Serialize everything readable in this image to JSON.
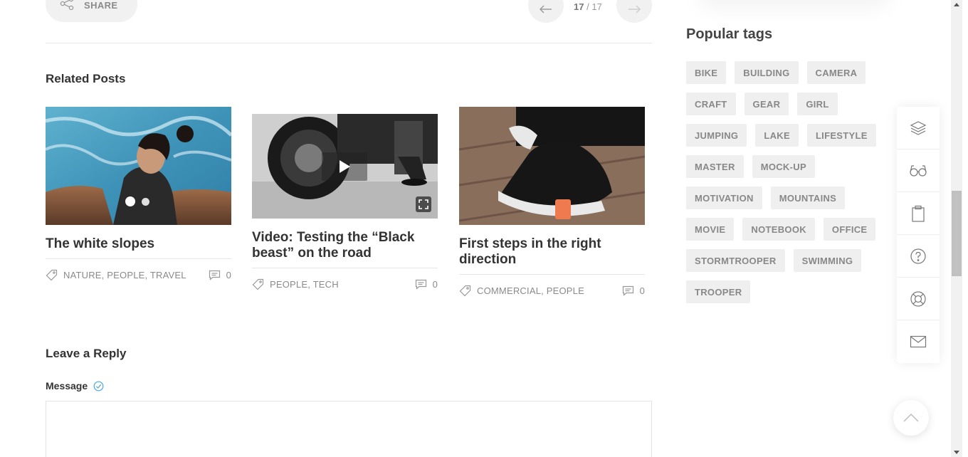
{
  "share": {
    "label": "SHARE"
  },
  "pager": {
    "current": "17",
    "total": "17",
    "separator": "/"
  },
  "related": {
    "title": "Related Posts",
    "posts": [
      {
        "title": "The white slopes",
        "tags": "NATURE, PEOPLE, TRAVEL",
        "comments": "0",
        "image": "woman-on-rocks-by-sea",
        "media": "gallery"
      },
      {
        "title": "Video: Testing the “Black beast” on the road",
        "tags": "PEOPLE, TECH",
        "comments": "0",
        "image": "motorcycle-wheel-bw",
        "media": "video"
      },
      {
        "title": "First steps in the right direction",
        "tags": "COMMERCIAL, PEOPLE",
        "comments": "0",
        "image": "sneaker-on-boardwalk",
        "media": "image"
      }
    ]
  },
  "reply": {
    "title": "Leave a Reply",
    "message_label": "Message"
  },
  "sidebar": {
    "popular_tags_title": "Popular tags",
    "tags": [
      "BIKE",
      "BUILDING",
      "CAMERA",
      "CRAFT",
      "GEAR",
      "GIRL",
      "JUMPING",
      "LAKE",
      "LIFESTYLE",
      "MASTER",
      "MOCK-UP",
      "MOTIVATION",
      "MOUNTAINS",
      "MOVIE",
      "NOTEBOOK",
      "OFFICE",
      "STORMTROOPER",
      "SWIMMING",
      "TROOPER"
    ],
    "dock_icons": [
      "layers-icon",
      "glasses-icon",
      "clipboard-icon",
      "help-icon",
      "lifebuoy-icon",
      "mail-icon"
    ]
  },
  "colors": {
    "text": "#333333",
    "muted": "#8a8a8a",
    "tag_bg": "#efefef",
    "accent": "#4aa8d8"
  }
}
